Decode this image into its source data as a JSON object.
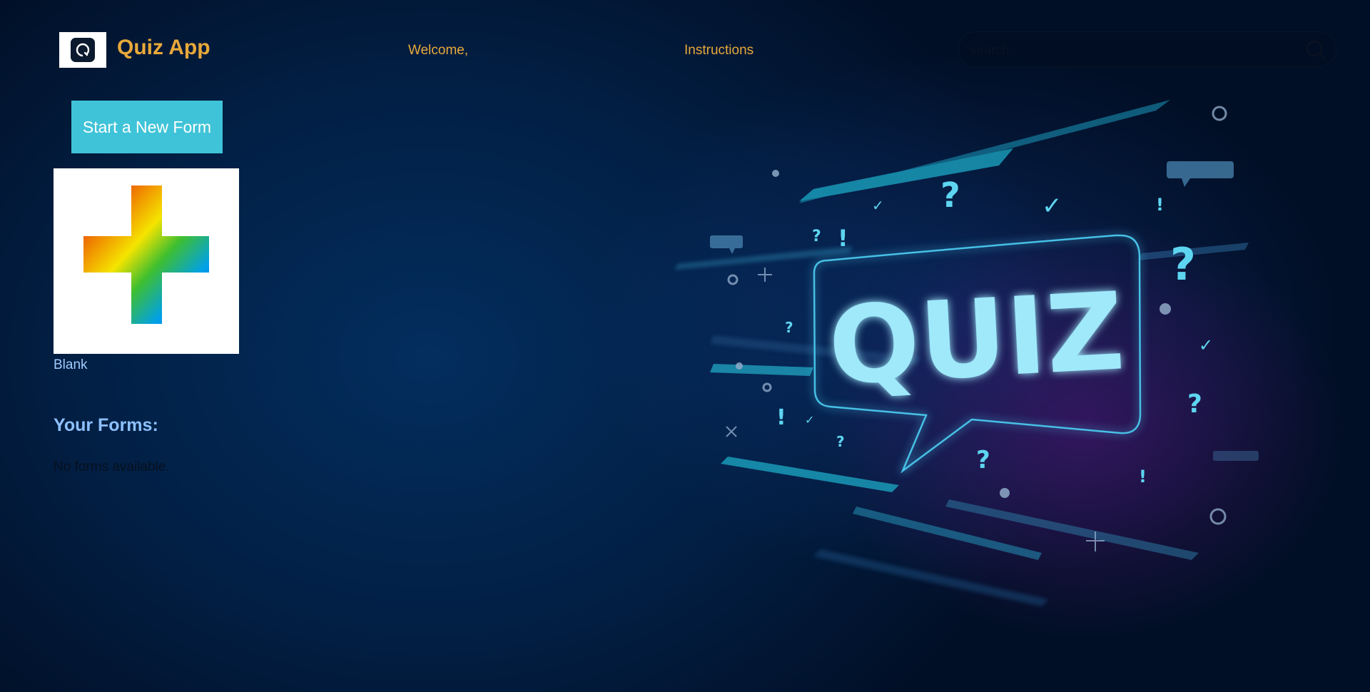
{
  "header": {
    "app_title": "Quiz App",
    "welcome_label": "Welcome,",
    "instructions_label": "Instructions",
    "search_placeholder": "search"
  },
  "sidebar": {
    "new_form_button": "Start a New Form",
    "blank_template_label": "Blank",
    "your_forms_heading": "Your Forms:",
    "empty_message": "No forms available."
  },
  "hero": {
    "word": "QUIZ"
  },
  "colors": {
    "accent_orange": "#e8a93a",
    "button_teal": "#3fc3d8",
    "link_blue": "#9ecbff",
    "background_navy": "#021f44",
    "glow_cyan": "#8fe6fb"
  },
  "icons": {
    "logo": "app-logo-icon",
    "search": "search-icon",
    "blank_template": "rainbow-plus-icon"
  }
}
